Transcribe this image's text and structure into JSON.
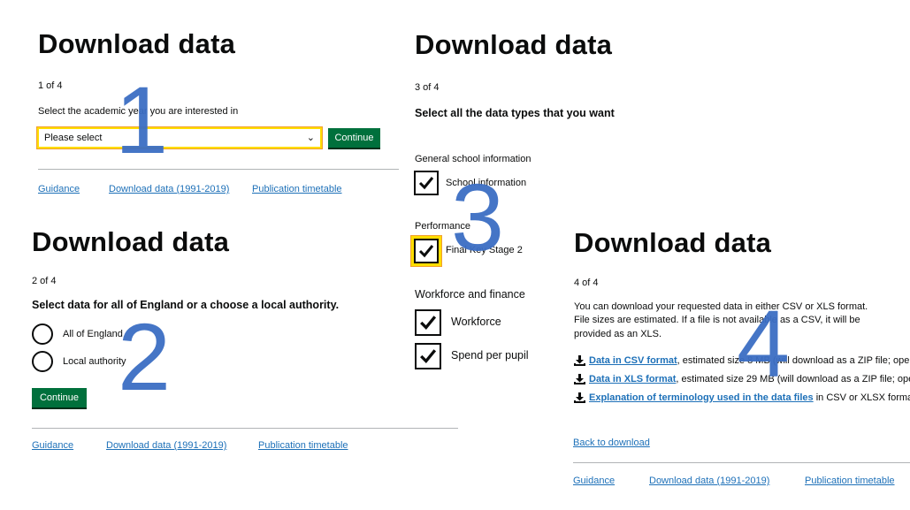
{
  "panel1": {
    "title": "Download data",
    "step": "1 of 4",
    "label": "Select the academic year you are interested in",
    "select_value": "Please select",
    "continue": "Continue",
    "footer_links": [
      "Guidance",
      "Download data (1991-2019)",
      "Publication timetable"
    ],
    "marker": "1"
  },
  "panel2": {
    "title": "Download data",
    "step": "2 of 4",
    "question": "Select data for all of England or a choose a local authority.",
    "options": [
      "All of England",
      "Local authority"
    ],
    "continue": "Continue",
    "footer_links": [
      "Guidance",
      "Download data (1991-2019)",
      "Publication timetable"
    ],
    "marker": "2"
  },
  "panel3": {
    "title": "Download data",
    "step": "3 of 4",
    "question": "Select all the data types that you want",
    "groups": [
      {
        "heading": "General school information",
        "items": [
          "School information"
        ]
      },
      {
        "heading": "Performance",
        "items": [
          "Final Key Stage 2"
        ]
      },
      {
        "heading": "Workforce and finance",
        "items": [
          "Workforce",
          "Spend per pupil"
        ]
      }
    ],
    "marker": "3"
  },
  "panel4": {
    "title": "Download data",
    "step": "4 of 4",
    "intro_lines": [
      "You can download your requested data in either CSV or XLS format.",
      "File sizes are estimated. If a file is not available as a CSV, it will be",
      "provided as an XLS."
    ],
    "downloads": [
      {
        "link": "Data in CSV format",
        "rest": ", estimated size 8 MB (will download as a ZIP file; ope"
      },
      {
        "link": "Data in XLS format",
        "rest": ", estimated size 29 MB (will download as a ZIP file; ope"
      },
      {
        "link": "Explanation of terminology used in the data files",
        "rest": " in CSV or XLSX format,"
      }
    ],
    "back_link": "Back to download",
    "footer_links": [
      "Guidance",
      "Download data (1991-2019)",
      "Publication timetable"
    ],
    "marker": "4"
  },
  "colors": {
    "button_green": "#00703c",
    "link_blue": "#1d70b8",
    "focus_yellow": "#ffdd00",
    "marker_blue": "#3c6ec4"
  }
}
